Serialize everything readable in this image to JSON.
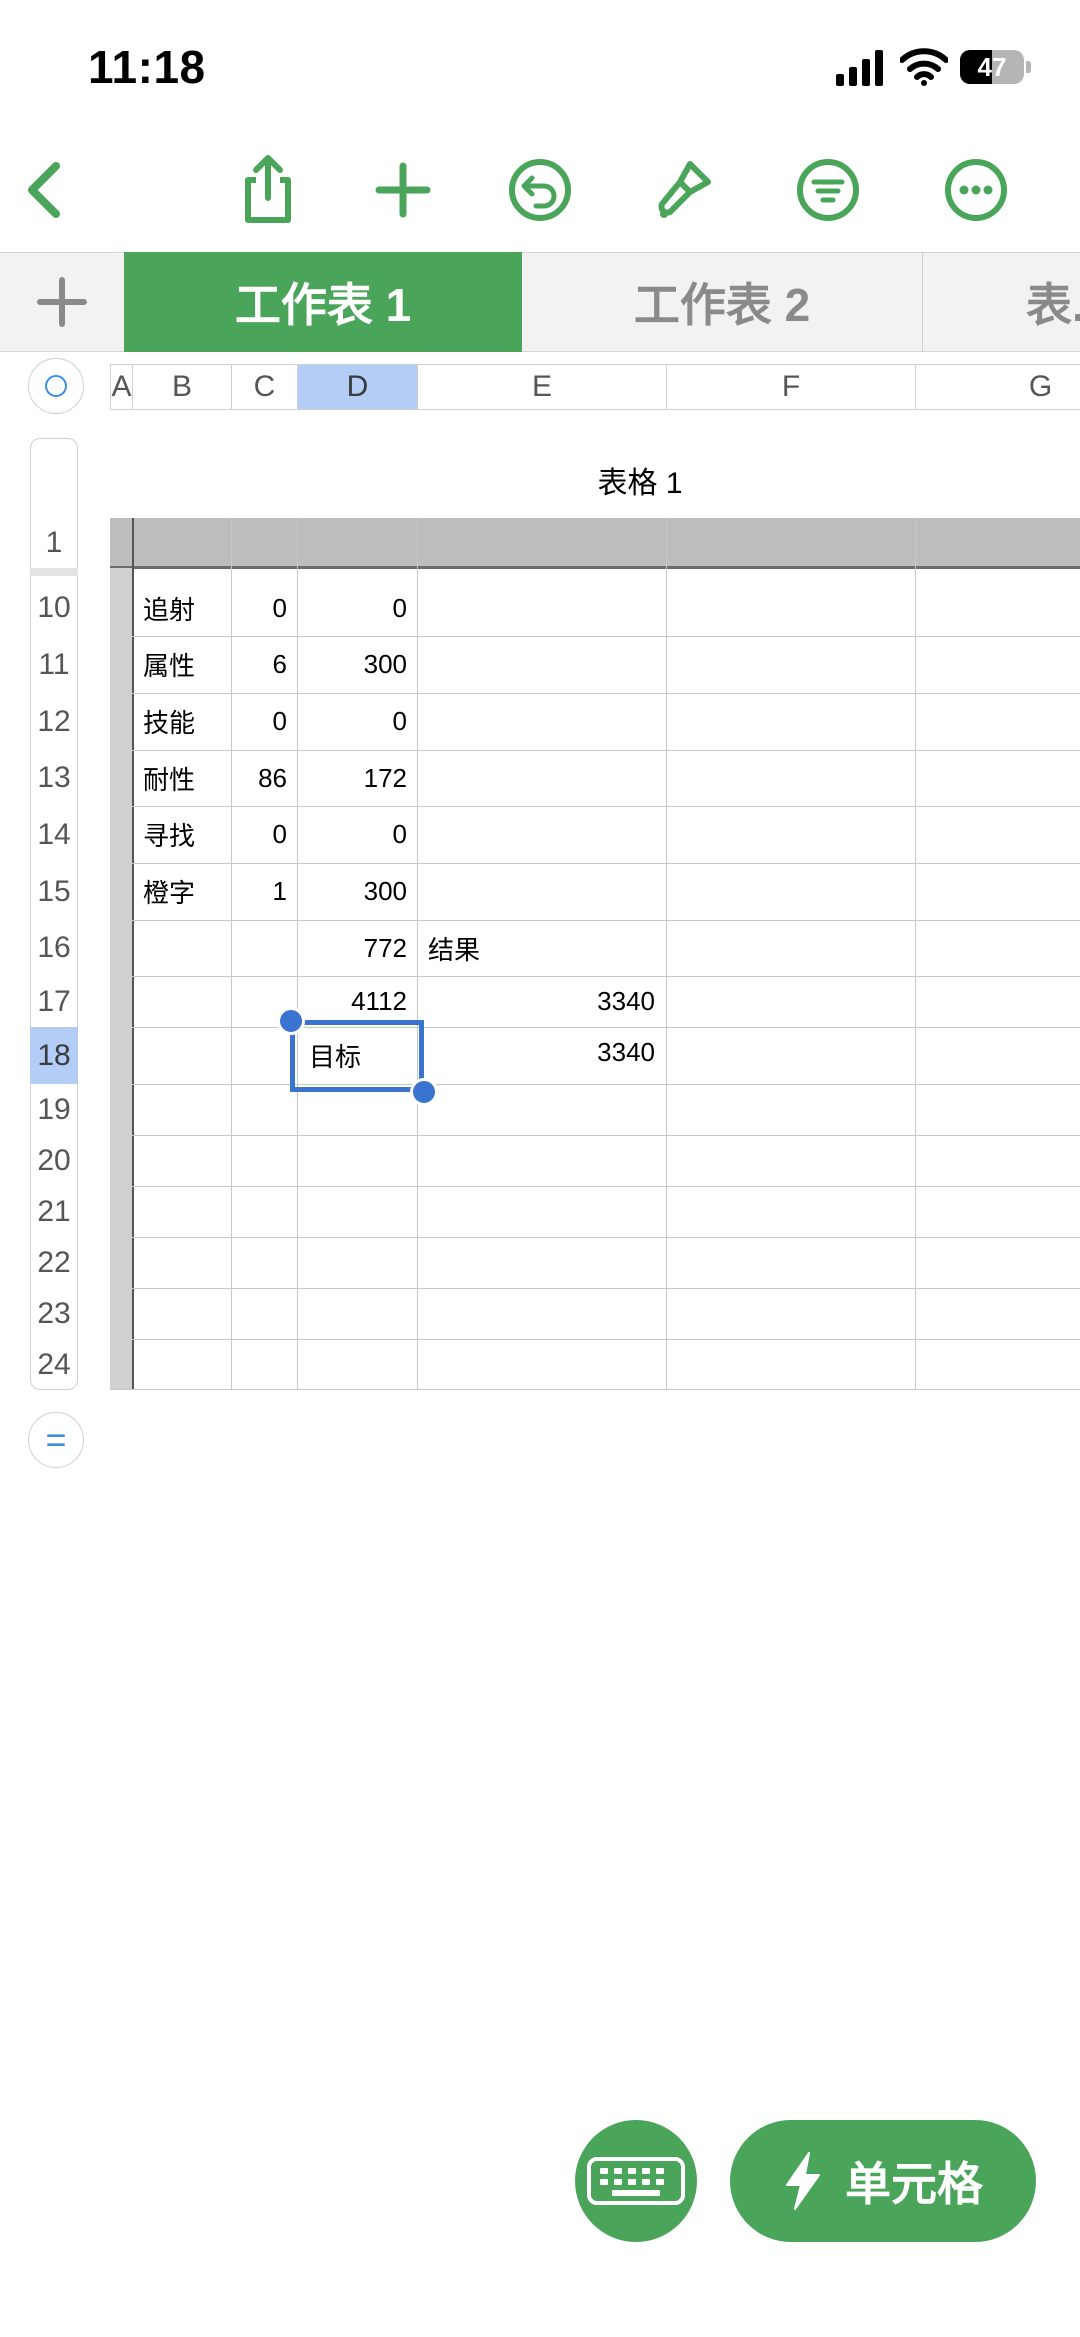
{
  "status_bar": {
    "time": "11:18",
    "battery": "47"
  },
  "toolbar": {
    "icons": [
      "back-icon",
      "share-icon",
      "add-icon",
      "undo-icon",
      "format-brush-icon",
      "filter-icon",
      "more-icon"
    ]
  },
  "sheets": {
    "tabs": [
      "工作表 1",
      "工作表 2",
      "表..."
    ],
    "active": 0
  },
  "columns": [
    "A",
    "B",
    "C",
    "D",
    "E",
    "F",
    "G"
  ],
  "selected_column": "D",
  "rows": [
    "1",
    "10",
    "11",
    "12",
    "13",
    "14",
    "15",
    "16",
    "17",
    "18",
    "19",
    "20",
    "21",
    "22",
    "23",
    "24"
  ],
  "selected_row": "18",
  "table": {
    "title": "表格 1",
    "cells": {
      "r10": {
        "B": "追射",
        "C": "0",
        "D": "0"
      },
      "r11": {
        "B": "属性",
        "C": "6",
        "D": "300"
      },
      "r12": {
        "B": "技能",
        "C": "0",
        "D": "0"
      },
      "r13": {
        "B": "耐性",
        "C": "86",
        "D": "172"
      },
      "r14": {
        "B": "寻找",
        "C": "0",
        "D": "0"
      },
      "r15": {
        "B": "橙字",
        "C": "1",
        "D": "300"
      },
      "r16": {
        "D": "772",
        "E": "结果"
      },
      "r17": {
        "D": "4112",
        "E": "3340"
      },
      "r18": {
        "D": "目标",
        "E": "3340"
      }
    }
  },
  "buttons": {
    "cell_label": "单元格"
  },
  "colors": {
    "accent": "#4aa55b",
    "selection": "#3b73d1",
    "selected_header": "#b3cdf7"
  }
}
